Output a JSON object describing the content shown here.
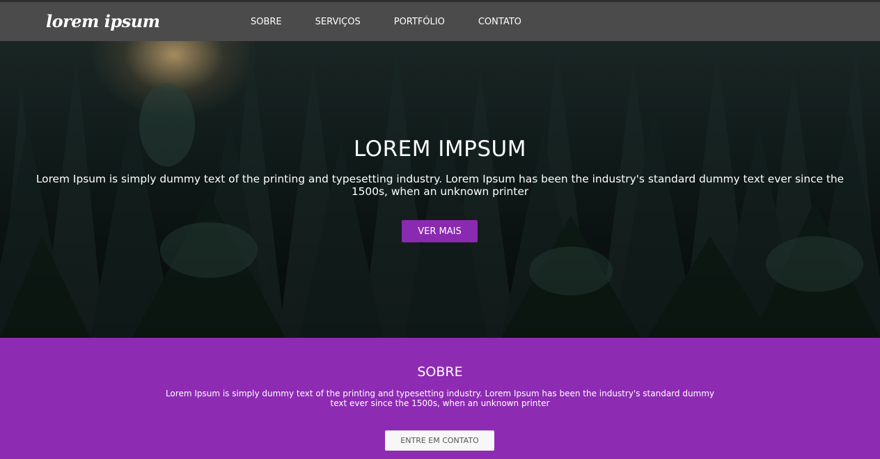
{
  "brand": {
    "logo_text": "lorem ipsum"
  },
  "nav": {
    "items": [
      {
        "label": "SOBRE"
      },
      {
        "label": "SERVIÇOS"
      },
      {
        "label": "PORTFÓLIO"
      },
      {
        "label": "CONTATO"
      }
    ]
  },
  "hero": {
    "title": "LOREM IMPSUM",
    "text": "Lorem Ipsum is simply dummy text of the printing and typesetting industry. Lorem Ipsum has been the industry's standard dummy text ever since the 1500s, when an unknown printer",
    "button_label": "VER MAIS"
  },
  "about": {
    "title": "SOBRE",
    "text": "Lorem Ipsum is simply dummy text of the printing and typesetting industry. Lorem Ipsum has been the industry's standard dummy text ever since the 1500s, when an unknown printer",
    "button_label": "ENTRE EM CONTATO"
  },
  "colors": {
    "nav_background": "#4b4b4b",
    "accent_purple": "#8e2bb3",
    "button_purple": "#8a2ab0",
    "light_button": "#f7f7f7"
  }
}
